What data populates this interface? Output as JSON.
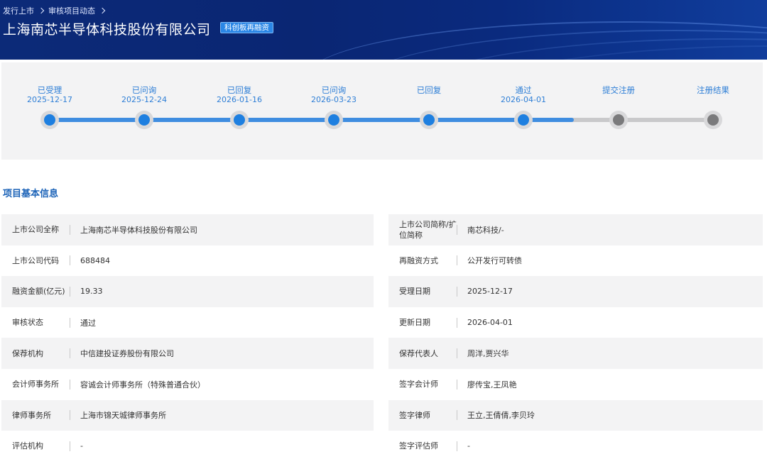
{
  "header": {
    "breadcrumb": [
      "发行上市",
      "审核项目动态"
    ],
    "company_name": "上海南芯半导体科技股份有限公司",
    "badge": "科创板再融资"
  },
  "progress": {
    "steps": [
      {
        "label": "已受理",
        "date": "2025-12-17",
        "status": "done"
      },
      {
        "label": "已问询",
        "date": "2025-12-24",
        "status": "done"
      },
      {
        "label": "已回复",
        "date": "2026-01-16",
        "status": "done"
      },
      {
        "label": "已问询",
        "date": "2026-03-23",
        "status": "done"
      },
      {
        "label": "已回复",
        "date": "",
        "status": "done"
      },
      {
        "label": "通过",
        "date": "2026-04-01",
        "status": "done"
      },
      {
        "label": "提交注册",
        "date": "",
        "status": "pending"
      },
      {
        "label": "注册结果",
        "date": "",
        "status": "pending"
      }
    ]
  },
  "section": {
    "title": "项目基本信息"
  },
  "info": {
    "left": [
      {
        "label": "上市公司全称",
        "value": "上海南芯半导体科技股份有限公司"
      },
      {
        "label": "上市公司代码",
        "value": "688484"
      },
      {
        "label": "融资金额(亿元)",
        "value": "19.33"
      },
      {
        "label": "审核状态",
        "value": "通过"
      },
      {
        "label": "保荐机构",
        "value": "中信建投证券股份有限公司"
      },
      {
        "label": "会计师事务所",
        "value": "容诚会计师事务所（特殊普通合伙）"
      },
      {
        "label": "律师事务所",
        "value": "上海市锦天城律师事务所"
      },
      {
        "label": "评估机构",
        "value": "-"
      }
    ],
    "right": [
      {
        "label": "上市公司简称/扩位简称",
        "value": "南芯科技/-"
      },
      {
        "label": "再融资方式",
        "value": "公开发行可转债"
      },
      {
        "label": "受理日期",
        "value": "2025-12-17"
      },
      {
        "label": "更新日期",
        "value": "2026-04-01"
      },
      {
        "label": "保荐代表人",
        "value": "周洋,贾兴华"
      },
      {
        "label": "签字会计师",
        "value": "廖传宝,王凤艳"
      },
      {
        "label": "签字律师",
        "value": "王立,王倩倩,李贝玲"
      },
      {
        "label": "签字评估师",
        "value": "-"
      }
    ]
  },
  "colors": {
    "banner": "#0a2673",
    "accent": "#1e7fe0",
    "progress_done": "#3f8de0",
    "progress_pending": "#7a7a7c",
    "section_title": "#1c63b8"
  }
}
